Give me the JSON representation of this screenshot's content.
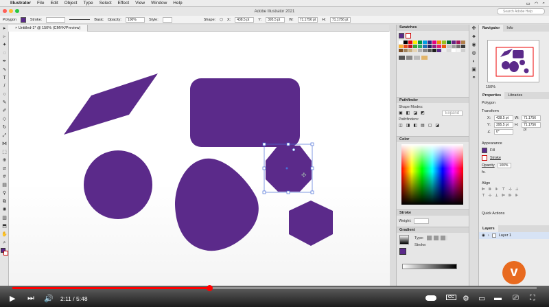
{
  "menubar": {
    "app": "Illustrator",
    "items": [
      "File",
      "Edit",
      "Object",
      "Type",
      "Select",
      "Effect",
      "View",
      "Window",
      "Help"
    ]
  },
  "window": {
    "title": "Adobe Illustrator 2021"
  },
  "search": {
    "placeholder": "Search Adobe Help"
  },
  "control": {
    "selection_type": "Polygon",
    "stroke_label": "Stroke:",
    "brush_value": "Basic",
    "opacity_label": "Opacity:",
    "opacity_value": "100%",
    "style_label": "Style:",
    "shape_label": "Shape:",
    "x_label": "X:",
    "x_value": "438.5 pt",
    "y_label": "Y:",
    "y_value": "395.5 pt",
    "w_label": "W:",
    "w_value": "71.1756 pt",
    "h_label": "H:",
    "h_value": "71.1756 pt"
  },
  "document": {
    "tab_label": "Untitled-1* @ 150% (CMYK/Preview)"
  },
  "panels": {
    "swatches": "Swatches",
    "pathfinder": "Pathfinder",
    "shape_modes": "Shape Modes:",
    "expand": "Expand",
    "pathfinders": "Pathfinders:",
    "color": "Color",
    "stroke": "Stroke",
    "weight": "Weight:",
    "gradient": "Gradient",
    "type_label": "Type:",
    "stroke_label": "Stroke:"
  },
  "right": {
    "navigator_tab": "Navigator",
    "info_tab": "Info",
    "zoom_value": "150%",
    "properties_tab": "Properties",
    "libraries_tab": "Libraries",
    "selection": "Polygon",
    "transform": "Transform",
    "x_label": "X:",
    "x_value": "438.5 pt",
    "y_label": "Y:",
    "y_value": "395.5 pt",
    "w_label": "W:",
    "w_value": "71.1756 pt",
    "h_label": "H:",
    "h_value": "71.1756 pt",
    "angle_value": "0°",
    "appearance": "Appearance",
    "fill": "Fill",
    "stroke": "Stroke",
    "opacity": "Opacity",
    "opacity_value": "100%",
    "fx": "fx.",
    "align": "Align",
    "quick_actions": "Quick Actions",
    "layers_tab": "Layers",
    "layer_name": "Layer 1"
  },
  "video": {
    "current_time": "2:11",
    "separator": "/",
    "duration": "5:48",
    "progress": 0.376,
    "cc_label": "CC"
  },
  "colors": {
    "shape_fill": "#5b2a8a",
    "selection": "#4a6fd8",
    "progress": "#ff0000",
    "logo": "#e86a1f"
  }
}
